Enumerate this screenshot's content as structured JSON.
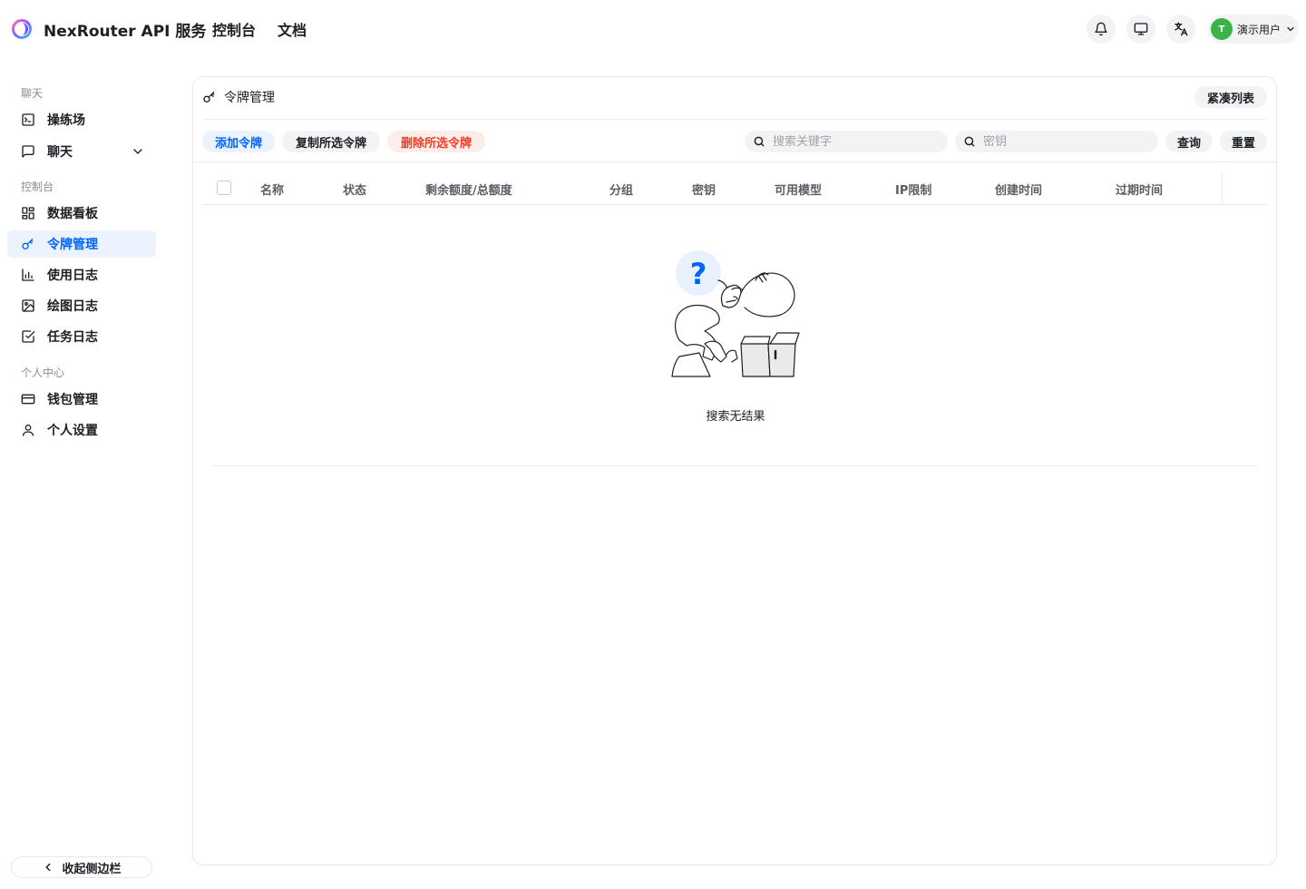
{
  "header": {
    "brand": "NexRouter API 服务",
    "nav": [
      "控制台",
      "文档"
    ],
    "user": {
      "initial": "T",
      "name": "演示用户"
    }
  },
  "sidebar": {
    "sections": {
      "chat": "聊天",
      "console": "控制台",
      "personal": "个人中心"
    },
    "items": {
      "playground": "操练场",
      "chat": "聊天",
      "dashboard": "数据看板",
      "tokens": "令牌管理",
      "usage_log": "使用日志",
      "drawing_log": "绘图日志",
      "task_log": "任务日志",
      "wallet": "钱包管理",
      "settings": "个人设置"
    },
    "collapse_label": "收起侧边栏"
  },
  "card": {
    "title": "令牌管理",
    "compact_label": "紧凑列表",
    "add_label": "添加令牌",
    "copy_label": "复制所选令牌",
    "delete_label": "删除所选令牌",
    "search_keyword_placeholder": "搜索关键字",
    "search_key_placeholder": "密钥",
    "query_label": "查询",
    "reset_label": "重置"
  },
  "table": {
    "columns": [
      "名称",
      "状态",
      "剩余额度/总额度",
      "分组",
      "密钥",
      "可用模型",
      "IP限制",
      "创建时间",
      "过期时间"
    ],
    "empty_text": "搜索无结果"
  },
  "colors": {
    "accent": "#0064fa",
    "danger": "#f93920",
    "avatar": "#3bb346"
  }
}
